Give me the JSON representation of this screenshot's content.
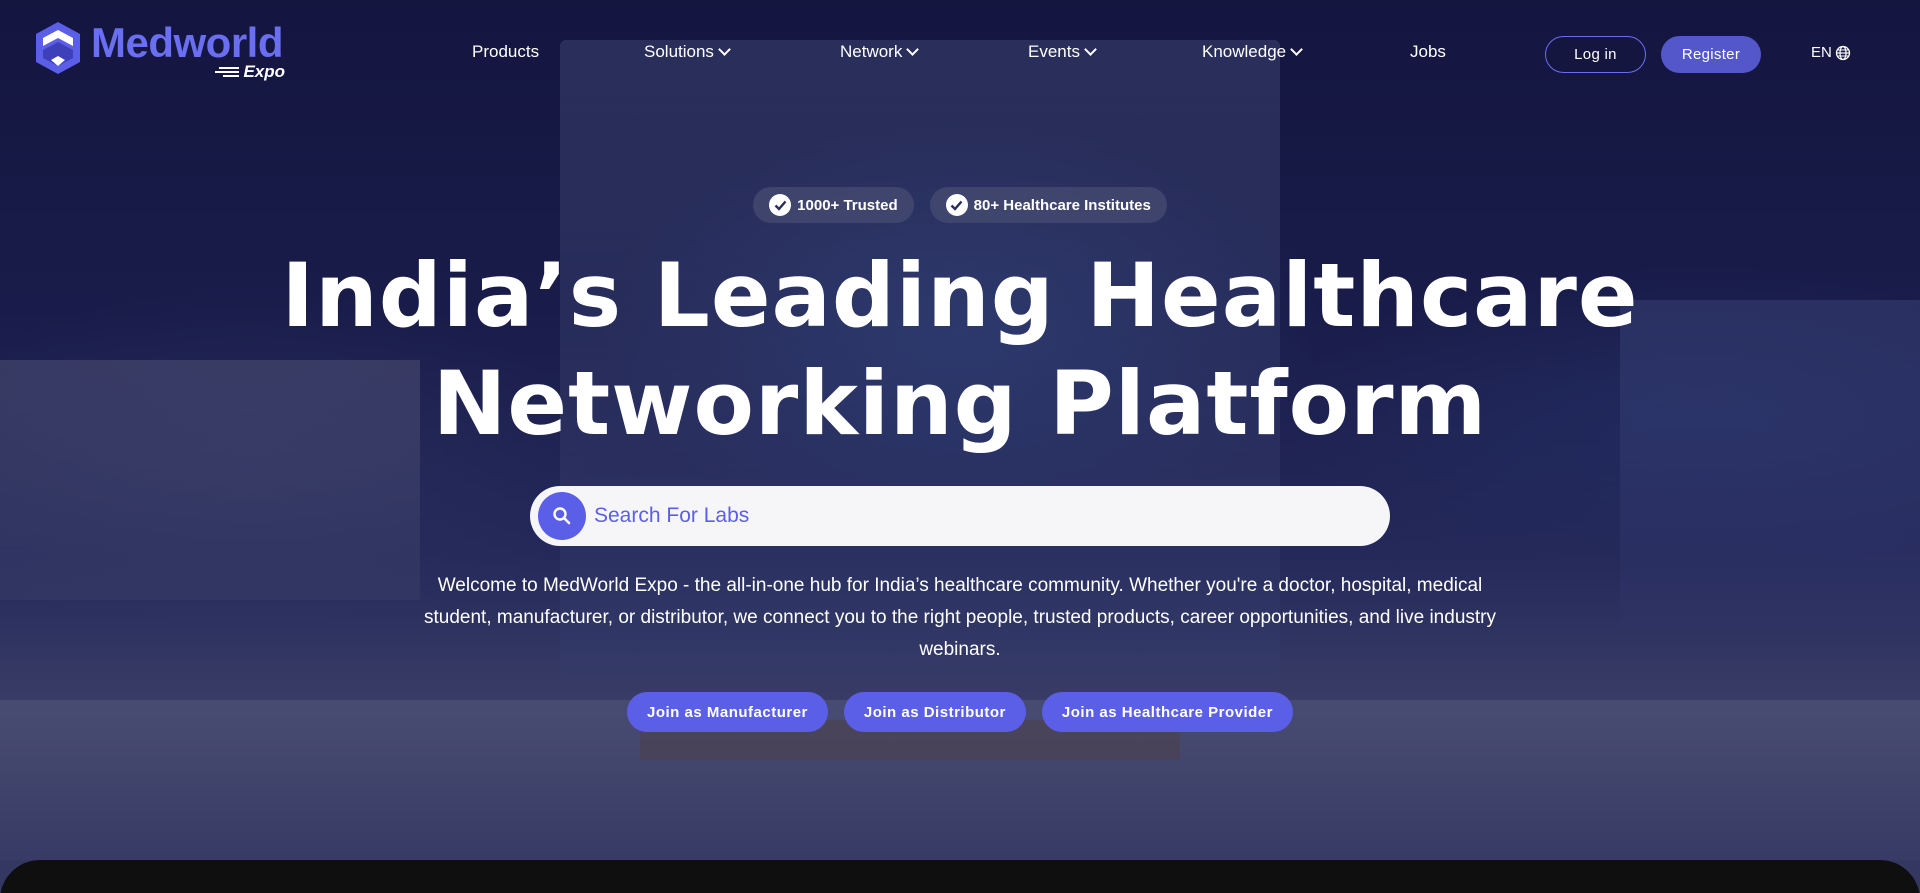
{
  "brand": {
    "name": "Medworld",
    "sub": "Expo",
    "accent": "#5b5fe8"
  },
  "nav": {
    "items": [
      {
        "label": "Products",
        "dropdown": false
      },
      {
        "label": "Solutions",
        "dropdown": true
      },
      {
        "label": "Network",
        "dropdown": true
      },
      {
        "label": "Events",
        "dropdown": true
      },
      {
        "label": "Knowledge",
        "dropdown": true
      },
      {
        "label": "Jobs",
        "dropdown": false
      }
    ],
    "login_label": "Log in",
    "register_label": "Register",
    "language": "EN"
  },
  "badges": [
    {
      "label": "1000+ Trusted",
      "icon": "check-circle-icon"
    },
    {
      "label": "80+ Healthcare Institutes",
      "icon": "check-circle-icon"
    }
  ],
  "hero": {
    "title_line1": "India’s Leading Healthcare",
    "title_line2": "Networking Platform",
    "description": "Welcome to MedWorld Expo - the all-in-one hub for India’s healthcare community. Whether you're a doctor, hospital, medical student, manufacturer, or distributor, we connect you to the right people, trusted products, career opportunities, and live industry webinars."
  },
  "search": {
    "placeholder": "Search For Labs",
    "value": ""
  },
  "ctas": [
    {
      "label": "Join as Manufacturer"
    },
    {
      "label": "Join as Distributor"
    },
    {
      "label": "Join as Healthcare Provider"
    }
  ]
}
